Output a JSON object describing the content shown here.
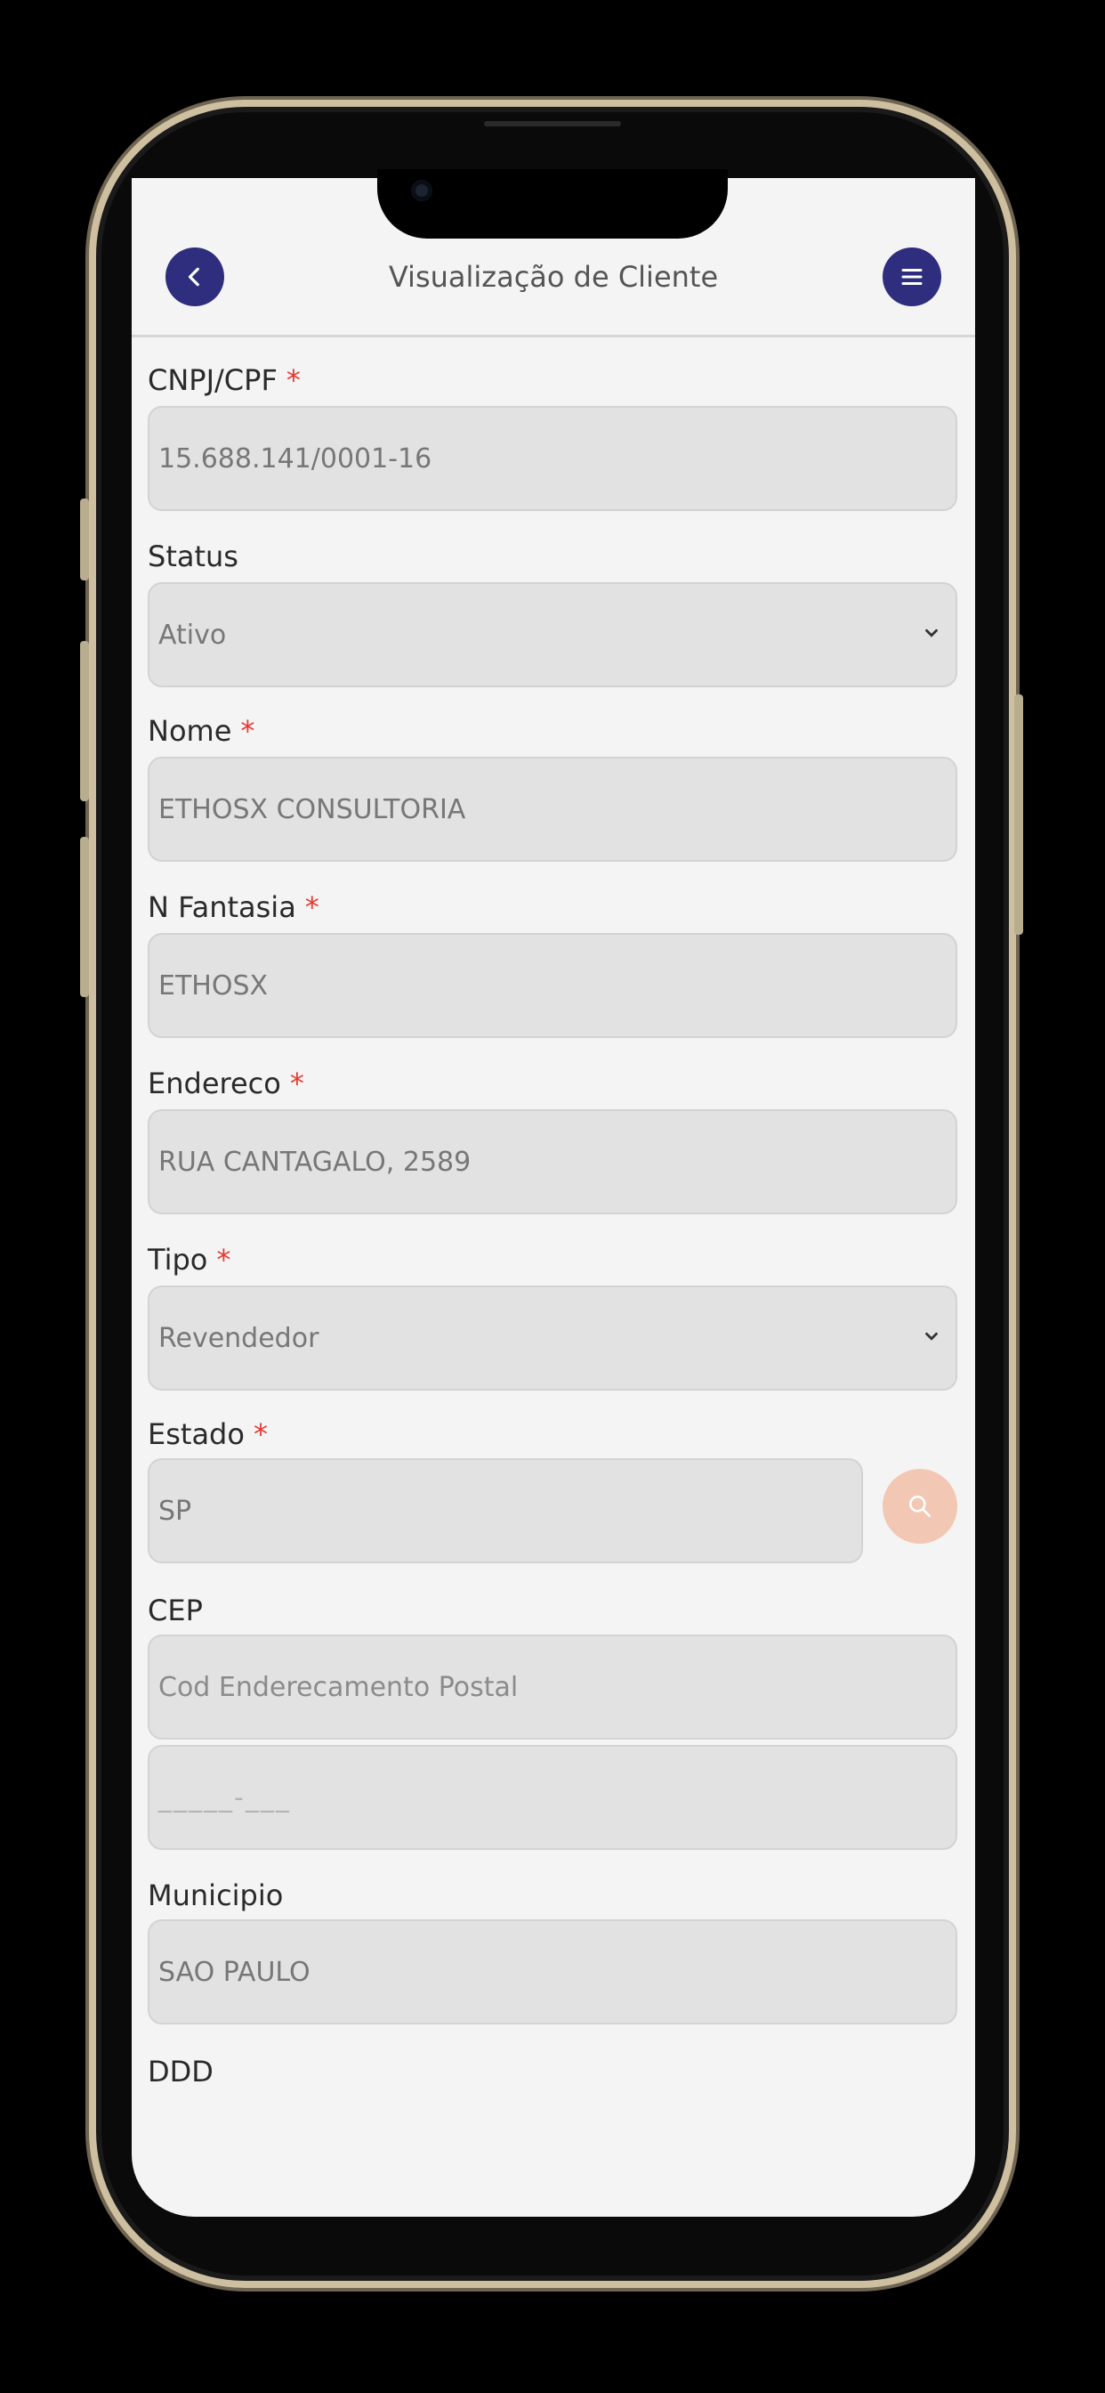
{
  "header": {
    "title": "Visualização de Cliente",
    "back_icon": "chevron-left-icon",
    "menu_icon": "hamburger-menu-icon",
    "accent": "#2e2d7e"
  },
  "form": {
    "required_marker": "*",
    "cnpj": {
      "label": "CNPJ/CPF",
      "value": "15.688.141/0001-16"
    },
    "status": {
      "label": "Status",
      "value": "Ativo"
    },
    "nome": {
      "label": "Nome",
      "value": "ETHOSX CONSULTORIA"
    },
    "fantasia": {
      "label": "N Fantasia",
      "value": "ETHOSX"
    },
    "endereco": {
      "label": "Endereco",
      "value": "RUA CANTAGALO, 2589"
    },
    "tipo": {
      "label": "Tipo",
      "value": "Revendedor"
    },
    "estado": {
      "label": "Estado",
      "value": "SP"
    },
    "cep": {
      "label": "CEP",
      "value": "Cod Enderecamento Postal",
      "mask_placeholder": "_____-___"
    },
    "municipio": {
      "label": "Municipio",
      "value": "SAO PAULO"
    },
    "ddd": {
      "label": "DDD"
    }
  },
  "colors": {
    "required": "#e53935",
    "search_button": "#f2c7b3"
  }
}
